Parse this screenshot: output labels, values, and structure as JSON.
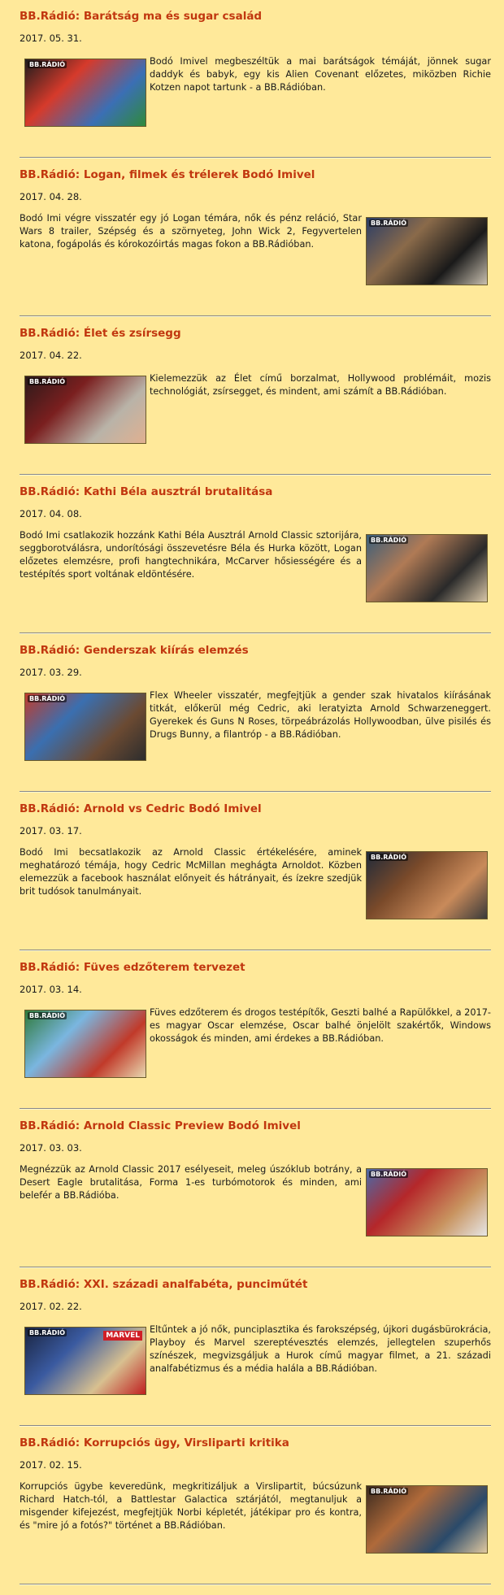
{
  "posts": [
    {
      "title": "BB.Rádió: Barátság ma és sugar család",
      "date": "2017. 05. 31.",
      "text": "Bodó Imivel megbeszéltük a mai barátságok témáját, jönnek sugar daddyk és babyk, egy kis Alien Covenant előzetes, miközben Richie Kotzen napot tartunk - a BB.Rádióban.",
      "image_side": "left",
      "logo": "BB.RÁDIÓ",
      "colors": [
        "#1d1d1d",
        "#d63a2b",
        "#3b6fb5",
        "#2f8a3b"
      ]
    },
    {
      "title": "BB.Rádió: Logan, filmek és trélerek Bodó Imivel",
      "date": "2017. 04. 28.",
      "text": "Bodó Imi végre visszatér egy jó Logan témára, nők és pénz reláció, Star Wars 8 trailer, Szépség és a szörnyeteg, John Wick 2, Fegyvertelen katona, fogápolás és kórokozóirtás magas fokon a BB.Rádióban.",
      "image_side": "right",
      "logo": "BB.RÁDIÓ",
      "colors": [
        "#2a3d66",
        "#8a6a4a",
        "#1a1a1a",
        "#c9c0b0"
      ]
    },
    {
      "title": "BB.Rádió: Élet és zsírsegg",
      "date": "2017. 04. 22.",
      "text": "Kielemezzük az Élet című borzalmat, Hollywood problémáit, mozis technológiát, zsírsegget, és mindent, ami számít a BB.Rádióban.",
      "image_side": "left",
      "logo": "BB.RÁDIÓ",
      "colors": [
        "#2b1a1a",
        "#7a1f1f",
        "#b9b3a8",
        "#e0b090"
      ]
    },
    {
      "title": "BB.Rádió: Kathi Béla ausztrál brutalitása",
      "date": "2017. 04. 08.",
      "text": "Bodó Imi csatlakozik hozzánk Kathi Béla Ausztrál Arnold Classic sztorijára, seggborotválásra, undorítósági összevetésre Béla és Hurka között, Logan előzetes elemzésre, profi hangtechnikára, McCarver hősiességére és a testépítés sport voltának eldöntésére.",
      "image_side": "right",
      "logo": "BB.RÁDIÓ",
      "colors": [
        "#3a5e7a",
        "#b07a55",
        "#2a2a2a",
        "#d8c6a8"
      ]
    },
    {
      "title": "BB.Rádió: Genderszak kiírás elemzés",
      "date": "2017. 03. 29.",
      "text": "Flex Wheeler visszatér, megfejtjük a gender szak hivatalos kiírásának titkát, előkerül még Cedric, aki leratyizta Arnold Schwarzeneggert. Gyerekek és Guns N Roses, törpeábrázolás Hollywoodban, ülve pisilés és Drugs Bunny, a filantróp - a BB.Rádióban.",
      "image_side": "left",
      "logo": "BB.RÁDIÓ",
      "colors": [
        "#c23b2b",
        "#3a6fb0",
        "#6b4a32",
        "#2d2d2d"
      ]
    },
    {
      "title": "BB.Rádió: Arnold vs Cedric Bodó Imivel",
      "date": "2017. 03. 17.",
      "text": "Bodó Imi becsatlakozik az Arnold Classic értékelésére, aminek meghatározó témája, hogy Cedric McMillan meghágta Arnoldot. Közben elemezzük a facebook használat előnyeit és hátrányait, és ízekre szedjük brit tudósok tanulmányait.",
      "image_side": "right",
      "logo": "BB.RÁDIÓ",
      "colors": [
        "#1f2a3a",
        "#7a4a2a",
        "#c98a5a",
        "#3a3a3a"
      ]
    },
    {
      "title": "BB.Rádió: Füves edzőterem tervezet",
      "date": "2017. 03. 14.",
      "text": "Füves edzőterem és drogos testépítők, Geszti balhé a Rapülőkkel, a 2017-es magyar Oscar elemzése, Oscar balhé önjelölt szakértők, Windows okosságok és minden, ami érdekes a BB.Rádióban.",
      "image_side": "left",
      "logo": "BB.RÁDIÓ",
      "colors": [
        "#2f7a3a",
        "#7ab6e0",
        "#c13a2a",
        "#e8d8b0"
      ]
    },
    {
      "title": "BB.Rádió: Arnold Classic Preview Bodó Imivel",
      "date": "2017. 03. 03.",
      "text": "Megnézzük az Arnold Classic 2017 esélyeseit, meleg úszóklub botrány, a Desert Eagle brutalitása, Forma 1-es turbómotorok és minden, ami belefér a BB.Rádióba.",
      "image_side": "right",
      "logo": "BB.RÁDIÓ",
      "colors": [
        "#4a6aa8",
        "#b5272a",
        "#c8935f",
        "#e6e6e6"
      ]
    },
    {
      "title": "BB.Rádió: XXI. századi analfabéta, punciműtét",
      "date": "2017. 02. 22.",
      "text": "Eltűntek a jó nők, punciplasztika és farokszépség, újkori dugásbürokrácia, Playboy és Marvel szereptévesztés elemzés, jellegtelen szuperhős színészek, megvizsgáljuk a Hurok című magyar filmet, a 21. századi analfabétizmus és a média halála a BB.Rádióban.",
      "image_side": "left",
      "logo": "BB.RÁDIÓ",
      "marvel": "MARVEL",
      "colors": [
        "#1a2440",
        "#3a5aa0",
        "#d8c090",
        "#c02020"
      ]
    },
    {
      "title": "BB.Rádió: Korrupciós ügy, Virsliparti kritika",
      "date": "2017. 02. 15.",
      "text": "Korrupciós ügybe keveredünk, megkritizáljuk a Virslipartit, búcsúzunk Richard Hatch-tól, a Battlestar Galactica sztárjától, megtanuljuk a misgender kifejezést, megfejtjük Norbi képletét, játékipar pro és kontra, és \"mire jó a fotós?\" történet a BB.Rádióban.",
      "image_side": "right",
      "logo": "BB.RÁDIÓ",
      "colors": [
        "#3a2a1f",
        "#b06a3a",
        "#2a4a6a",
        "#e0c8a0"
      ]
    }
  ]
}
